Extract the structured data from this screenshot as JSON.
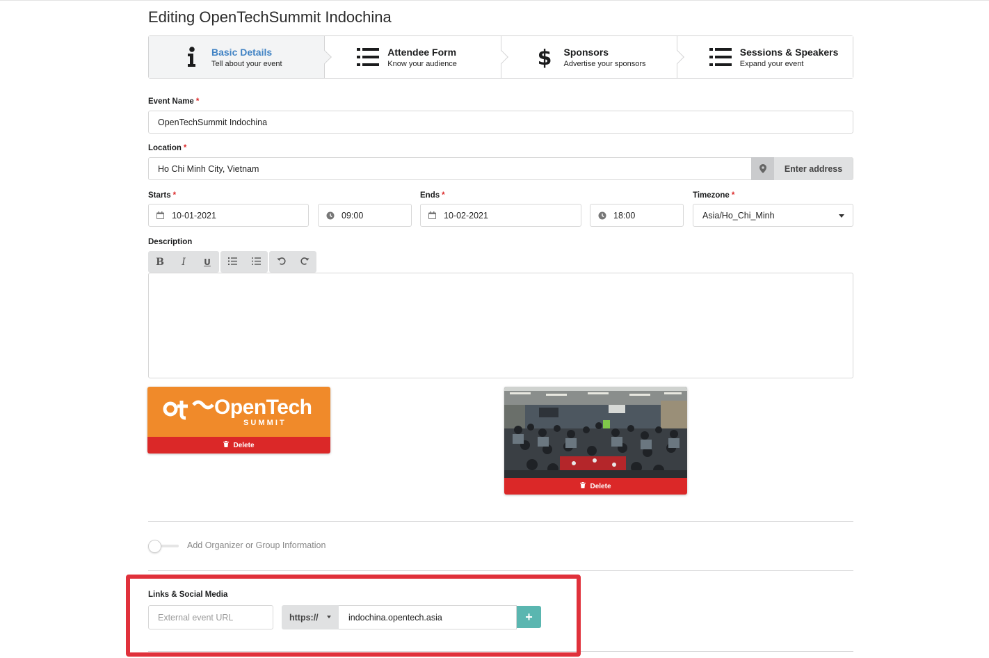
{
  "page": {
    "title": "Editing OpenTechSummit Indochina"
  },
  "steps": [
    {
      "title": "Basic Details",
      "description": "Tell about your event",
      "icon": "info-icon",
      "active": true
    },
    {
      "title": "Attendee Form",
      "description": "Know your audience",
      "icon": "list-icon",
      "active": false
    },
    {
      "title": "Sponsors",
      "description": "Advertise your sponsors",
      "icon": "dollar-icon",
      "active": false
    },
    {
      "title": "Sessions & Speakers",
      "description": "Expand your event",
      "icon": "list-icon",
      "active": false
    }
  ],
  "form": {
    "required_marker": "*",
    "event_name": {
      "label": "Event Name",
      "value": "OpenTechSummit Indochina"
    },
    "location": {
      "label": "Location",
      "value": "Ho Chi Minh City, Vietnam",
      "button_label": "Enter address"
    },
    "starts": {
      "label": "Starts",
      "date": "10-01-2021",
      "time": "09:00"
    },
    "ends": {
      "label": "Ends",
      "date": "10-02-2021",
      "time": "18:00"
    },
    "timezone": {
      "label": "Timezone",
      "value": "Asia/Ho_Chi_Minh"
    },
    "description": {
      "label": "Description",
      "toolbar": {
        "bold": "B",
        "italic": "I",
        "underline": "U"
      },
      "value": ""
    }
  },
  "images": {
    "logo": {
      "text_main": "OpenTech",
      "text_sub": "S U M M I T",
      "delete_label": "Delete"
    },
    "photo": {
      "delete_label": "Delete"
    }
  },
  "organizer": {
    "toggle_label": "Add Organizer or Group Information",
    "enabled": false
  },
  "links": {
    "label": "Links & Social Media",
    "external_placeholder": "External event URL",
    "protocol": "https://",
    "url_value": "indochina.opentech.asia",
    "add_symbol": "+"
  },
  "colors": {
    "accent_blue": "#4183c4",
    "delete_red": "#db2828",
    "logo_orange": "#f08a2a",
    "add_teal": "#5ab6b0",
    "highlight_red": "#e0313b"
  }
}
